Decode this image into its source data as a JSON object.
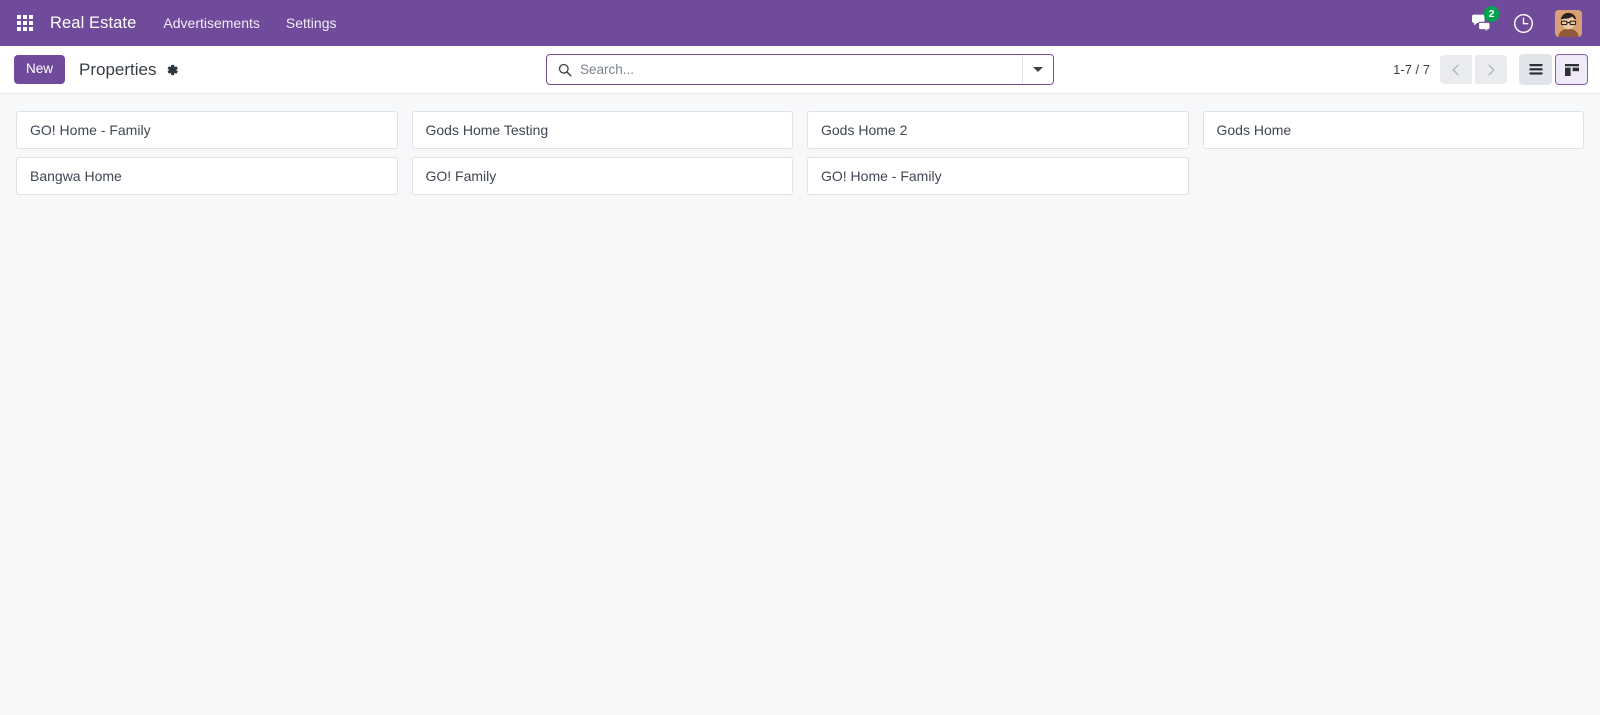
{
  "navbar": {
    "apps_icon": "apps-grid-icon",
    "brand": "Real Estate",
    "menu_items": [
      {
        "label": "Advertisements"
      },
      {
        "label": "Settings"
      }
    ],
    "tools": {
      "messages_icon": "messages-icon",
      "messages_count": "2",
      "activities_icon": "clock-icon",
      "avatar_icon": "user-avatar"
    }
  },
  "control_panel": {
    "new_label": "New",
    "breadcrumb_title": "Properties",
    "settings_icon": "gear-icon",
    "search": {
      "placeholder": "Search...",
      "value": "",
      "search_icon": "search-icon",
      "toggle_icon": "chevron-down-icon"
    },
    "pager": {
      "value": "1-7 / 7",
      "previous_icon": "chevron-left-icon",
      "next_icon": "chevron-right-icon"
    },
    "view_switcher": {
      "list_icon": "list-view-icon",
      "kanban_icon": "kanban-view-icon",
      "active": "kanban"
    }
  },
  "kanban": {
    "records": [
      {
        "title": "GO! Home - Family"
      },
      {
        "title": "Gods Home Testing"
      },
      {
        "title": "Gods Home 2"
      },
      {
        "title": "Gods Home"
      },
      {
        "title": "Bangwa Home"
      },
      {
        "title": "GO! Family"
      },
      {
        "title": "GO! Home - Family"
      }
    ]
  },
  "colors": {
    "brand_purple": "#714b9b",
    "badge_green": "#00a24e",
    "page_background": "#f7f8fa",
    "card_background": "#ffffff",
    "card_border": "#dfe2e7"
  }
}
